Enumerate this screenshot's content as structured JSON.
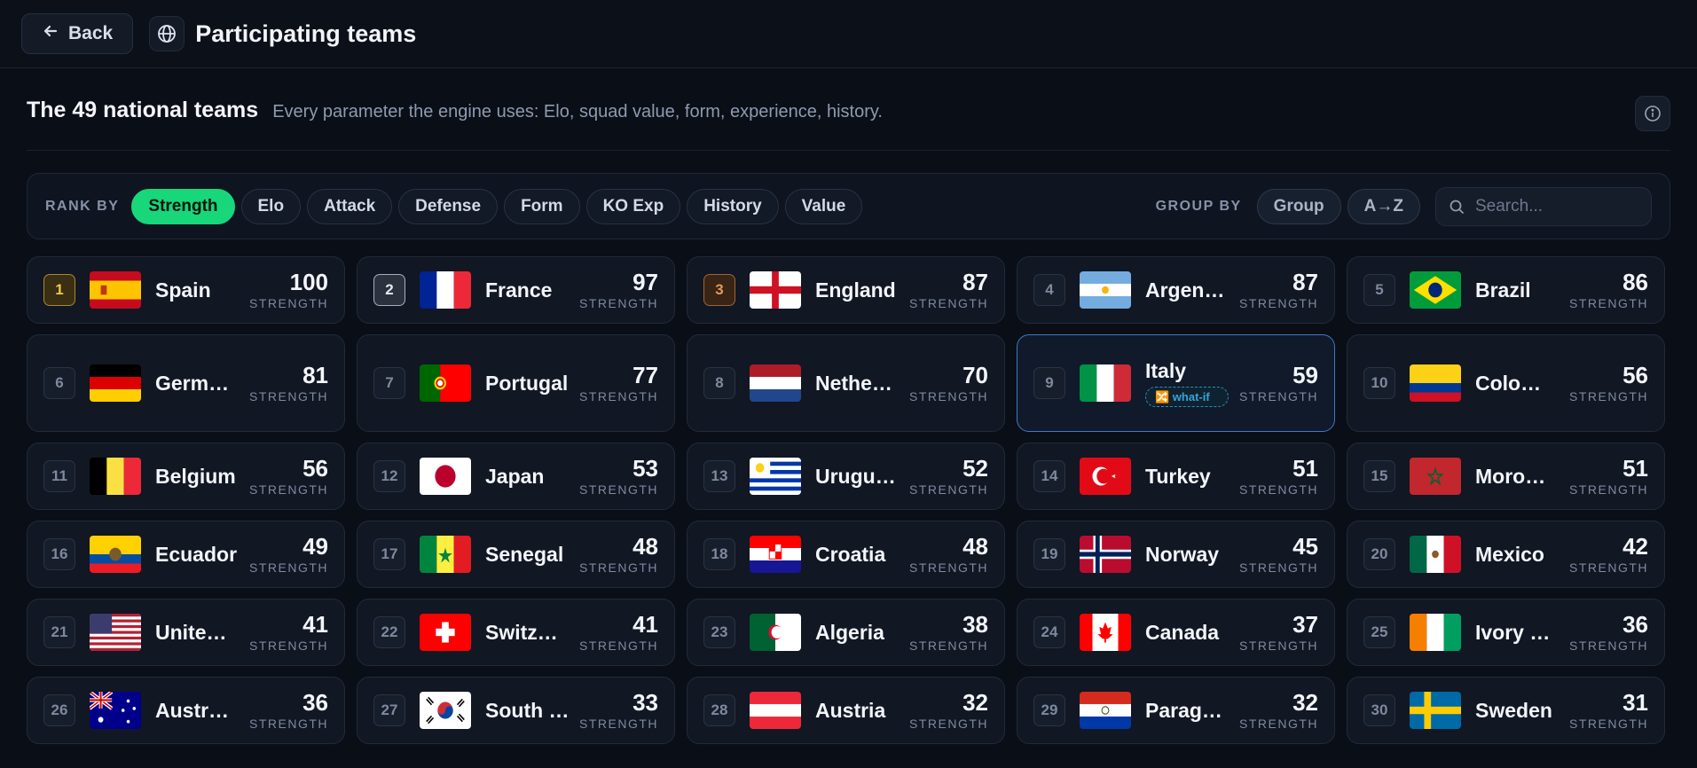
{
  "header": {
    "back_label": "Back",
    "title": "Participating teams"
  },
  "section": {
    "title": "The 49 national teams",
    "subtitle": "Every parameter the engine uses: Elo, squad value, form, experience, history."
  },
  "toolbar": {
    "rank_by_label": "RANK BY",
    "rank_options": [
      "Strength",
      "Elo",
      "Attack",
      "Defense",
      "Form",
      "KO Exp",
      "History",
      "Value"
    ],
    "active_rank": "Strength",
    "group_by_label": "GROUP BY",
    "group_options": [
      "Group",
      "A→Z"
    ],
    "search_placeholder": "Search..."
  },
  "score_label": "STRENGTH",
  "teams": [
    {
      "rank": "1",
      "name": "Spain",
      "score": "100",
      "flag": "spain"
    },
    {
      "rank": "2",
      "name": "France",
      "score": "97",
      "flag": "france"
    },
    {
      "rank": "3",
      "name": "England",
      "score": "87",
      "flag": "england"
    },
    {
      "rank": "4",
      "name": "Argen…",
      "score": "87",
      "flag": "argentina"
    },
    {
      "rank": "5",
      "name": "Brazil",
      "score": "86",
      "flag": "brazil"
    },
    {
      "rank": "6",
      "name": "Germ…",
      "score": "81",
      "flag": "germany"
    },
    {
      "rank": "7",
      "name": "Portugal",
      "score": "77",
      "flag": "portugal"
    },
    {
      "rank": "8",
      "name": "Nethe…",
      "score": "70",
      "flag": "netherlands"
    },
    {
      "rank": "9",
      "name": "Italy",
      "score": "59",
      "flag": "italy",
      "badge": "🔀 what-if"
    },
    {
      "rank": "10",
      "name": "Colo…",
      "score": "56",
      "flag": "colombia"
    },
    {
      "rank": "11",
      "name": "Belgium",
      "score": "56",
      "flag": "belgium"
    },
    {
      "rank": "12",
      "name": "Japan",
      "score": "53",
      "flag": "japan"
    },
    {
      "rank": "13",
      "name": "Urugu…",
      "score": "52",
      "flag": "uruguay"
    },
    {
      "rank": "14",
      "name": "Turkey",
      "score": "51",
      "flag": "turkey"
    },
    {
      "rank": "15",
      "name": "Moro…",
      "score": "51",
      "flag": "morocco"
    },
    {
      "rank": "16",
      "name": "Ecuador",
      "score": "49",
      "flag": "ecuador"
    },
    {
      "rank": "17",
      "name": "Senegal",
      "score": "48",
      "flag": "senegal"
    },
    {
      "rank": "18",
      "name": "Croatia",
      "score": "48",
      "flag": "croatia"
    },
    {
      "rank": "19",
      "name": "Norway",
      "score": "45",
      "flag": "norway"
    },
    {
      "rank": "20",
      "name": "Mexico",
      "score": "42",
      "flag": "mexico"
    },
    {
      "rank": "21",
      "name": "Unite…",
      "score": "41",
      "flag": "usa"
    },
    {
      "rank": "22",
      "name": "Switz…",
      "score": "41",
      "flag": "switzerland"
    },
    {
      "rank": "23",
      "name": "Algeria",
      "score": "38",
      "flag": "algeria"
    },
    {
      "rank": "24",
      "name": "Canada",
      "score": "37",
      "flag": "canada"
    },
    {
      "rank": "25",
      "name": "Ivory …",
      "score": "36",
      "flag": "ivorycoast"
    },
    {
      "rank": "26",
      "name": "Austr…",
      "score": "36",
      "flag": "australia"
    },
    {
      "rank": "27",
      "name": "South …",
      "score": "33",
      "flag": "southkorea"
    },
    {
      "rank": "28",
      "name": "Austria",
      "score": "32",
      "flag": "austria"
    },
    {
      "rank": "29",
      "name": "Parag…",
      "score": "32",
      "flag": "paraguay"
    },
    {
      "rank": "30",
      "name": "Sweden",
      "score": "31",
      "flag": "sweden"
    }
  ],
  "colors": {
    "accent": "#18d67a",
    "background": "#0a0e16",
    "card": "#111723",
    "selected_border": "#3f79c8",
    "gold": "#f1c84f",
    "bronze": "#e09a5b"
  }
}
